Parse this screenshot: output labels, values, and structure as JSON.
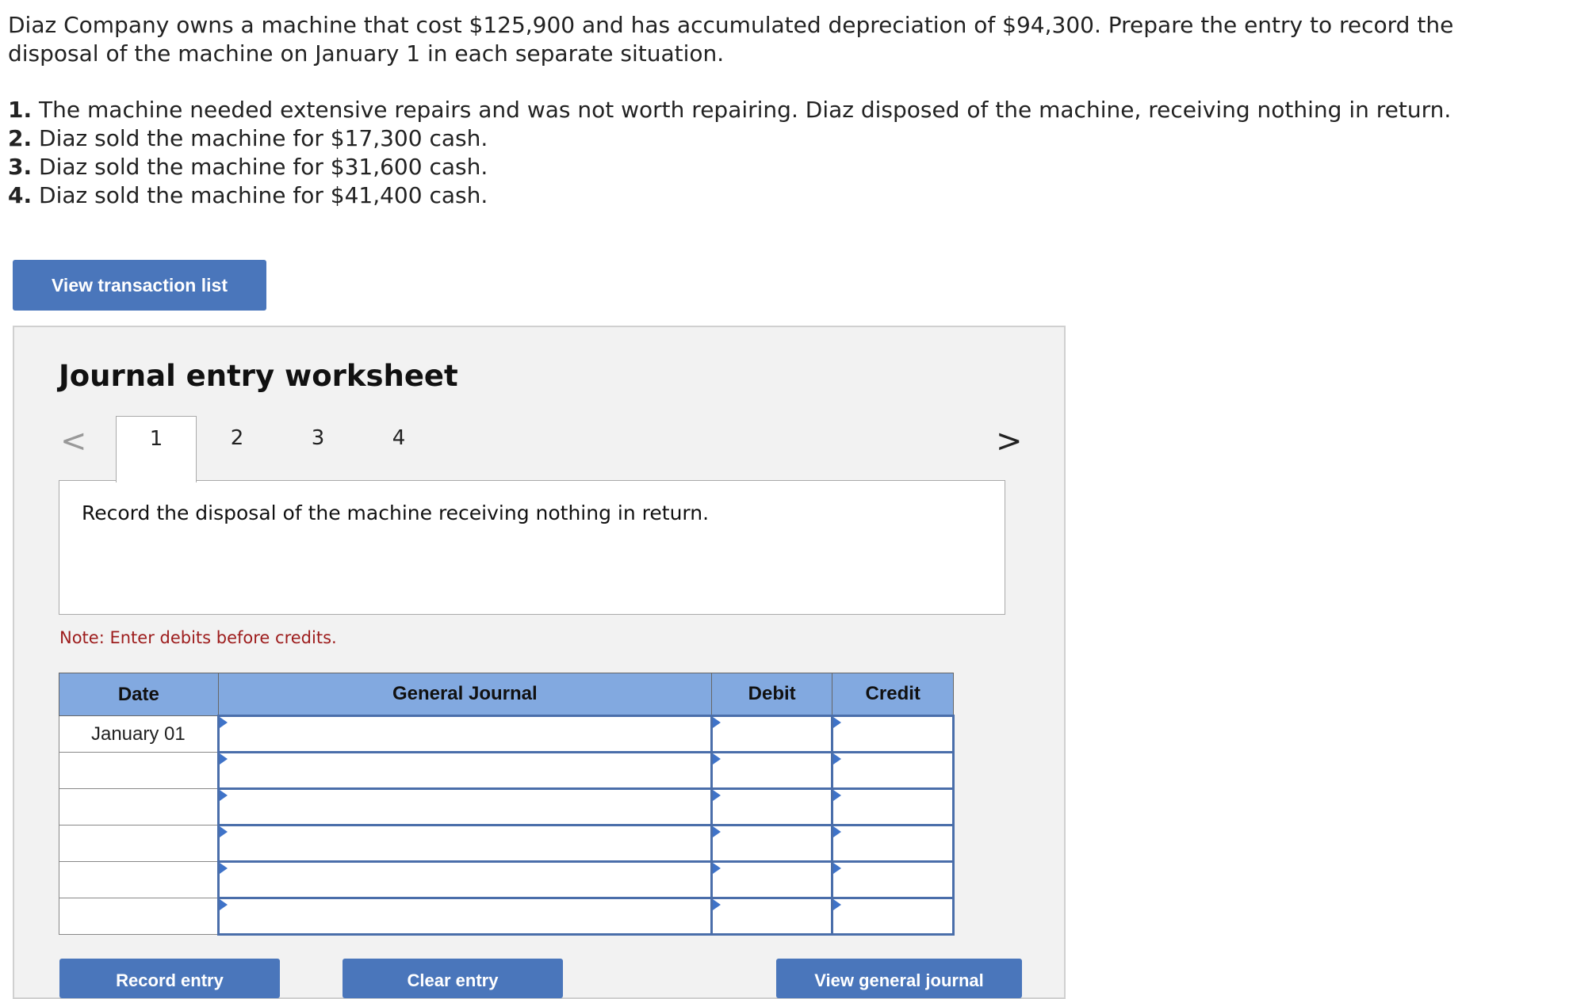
{
  "problem": {
    "intro": "Diaz Company owns a machine that cost $125,900 and has accumulated depreciation of $94,300. Prepare the entry to record the disposal of the machine on January 1 in each separate situation.",
    "requirements": [
      {
        "num": "1.",
        "text": "The machine needed extensive repairs and was not worth repairing. Diaz disposed of the machine, receiving nothing in return."
      },
      {
        "num": "2.",
        "text": "Diaz sold the machine for $17,300 cash."
      },
      {
        "num": "3.",
        "text": "Diaz sold the machine for $31,600 cash."
      },
      {
        "num": "4.",
        "text": "Diaz sold the machine for $41,400 cash."
      }
    ]
  },
  "buttons": {
    "view_transaction_list": "View transaction list",
    "record_entry": "Record entry",
    "clear_entry": "Clear entry",
    "view_general_journal": "View general journal"
  },
  "worksheet": {
    "title": "Journal entry worksheet",
    "tabs": [
      "1",
      "2",
      "3",
      "4"
    ],
    "active_tab": "1",
    "prev_arrow": "<",
    "next_arrow": ">",
    "instruction": "Record the disposal of the machine receiving nothing in return.",
    "note": "Note: Enter debits before credits."
  },
  "journal": {
    "headers": {
      "date": "Date",
      "general_journal": "General Journal",
      "debit": "Debit",
      "credit": "Credit"
    },
    "rows": [
      {
        "date": "January 01",
        "account": "",
        "debit": "",
        "credit": ""
      },
      {
        "date": "",
        "account": "",
        "debit": "",
        "credit": ""
      },
      {
        "date": "",
        "account": "",
        "debit": "",
        "credit": ""
      },
      {
        "date": "",
        "account": "",
        "debit": "",
        "credit": ""
      },
      {
        "date": "",
        "account": "",
        "debit": "",
        "credit": ""
      },
      {
        "date": "",
        "account": "",
        "debit": "",
        "credit": ""
      }
    ]
  },
  "colors": {
    "button_blue": "#4a76bb",
    "table_header": "#82a9e0",
    "note_red": "#9d1c1c",
    "cell_border": "#4a6eaa"
  }
}
